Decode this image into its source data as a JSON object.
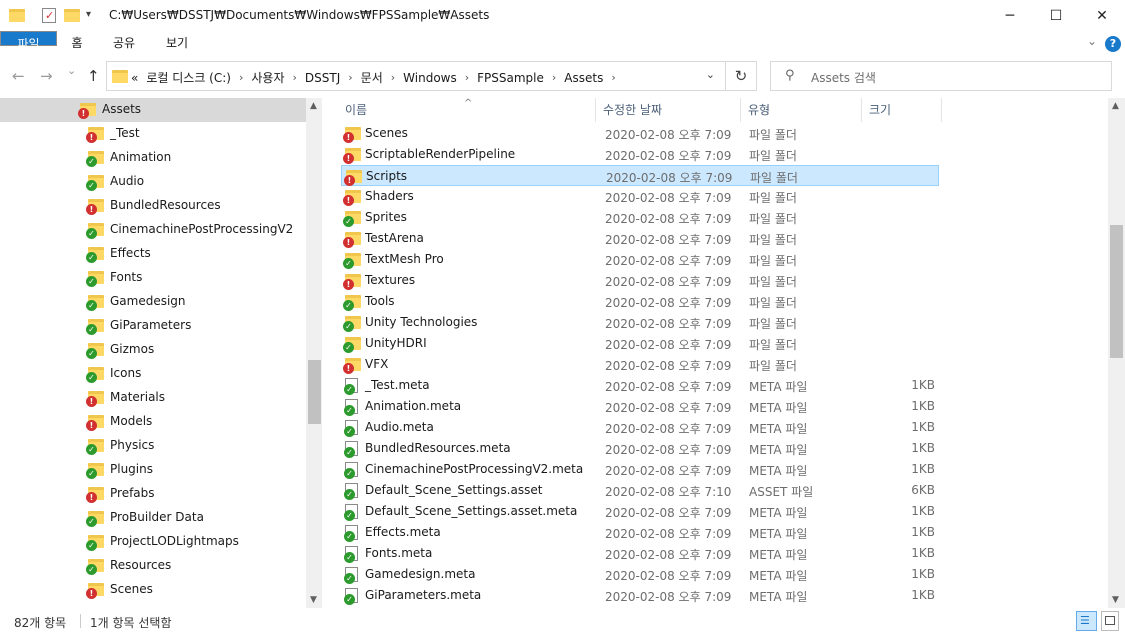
{
  "window": {
    "path": "C:₩Users₩DSSTJ₩Documents₩Windows₩FPSSample₩Assets",
    "minimize": "─",
    "maximize": "☐",
    "close": "✕"
  },
  "ribbon": {
    "tabs": [
      "파일",
      "홈",
      "공유",
      "보기"
    ],
    "help": "?"
  },
  "nav": {
    "back": "←",
    "forward": "→",
    "recent": "⌄",
    "up": "↑",
    "breadcrumb": [
      "«",
      "로컬 디스크 (C:)",
      "사용자",
      "DSSTJ",
      "문서",
      "Windows",
      "FPSSample",
      "Assets"
    ],
    "refresh": "↻",
    "search_placeholder": "Assets 검색"
  },
  "tree": {
    "selected": "Assets",
    "items": [
      {
        "label": "Assets",
        "status": "err"
      },
      {
        "label": "_Test",
        "status": "err"
      },
      {
        "label": "Animation",
        "status": "ok"
      },
      {
        "label": "Audio",
        "status": "ok"
      },
      {
        "label": "BundledResources",
        "status": "err"
      },
      {
        "label": "CinemachinePostProcessingV2",
        "status": "ok"
      },
      {
        "label": "Effects",
        "status": "ok"
      },
      {
        "label": "Fonts",
        "status": "ok"
      },
      {
        "label": "Gamedesign",
        "status": "ok"
      },
      {
        "label": "GiParameters",
        "status": "ok"
      },
      {
        "label": "Gizmos",
        "status": "ok"
      },
      {
        "label": "Icons",
        "status": "ok"
      },
      {
        "label": "Materials",
        "status": "err"
      },
      {
        "label": "Models",
        "status": "err"
      },
      {
        "label": "Physics",
        "status": "ok"
      },
      {
        "label": "Plugins",
        "status": "ok"
      },
      {
        "label": "Prefabs",
        "status": "err"
      },
      {
        "label": "ProBuilder Data",
        "status": "ok"
      },
      {
        "label": "ProjectLODLightmaps",
        "status": "ok"
      },
      {
        "label": "Resources",
        "status": "ok"
      },
      {
        "label": "Scenes",
        "status": "err"
      }
    ]
  },
  "columns": [
    "이름",
    "수정한 날짜",
    "유형",
    "크기"
  ],
  "files": [
    {
      "name": "Scenes",
      "date": "2020-02-08 오후 7:09",
      "type": "파일 폴더",
      "size": "",
      "kind": "folder",
      "status": "err"
    },
    {
      "name": "ScriptableRenderPipeline",
      "date": "2020-02-08 오후 7:09",
      "type": "파일 폴더",
      "size": "",
      "kind": "folder",
      "status": "err"
    },
    {
      "name": "Scripts",
      "date": "2020-02-08 오후 7:09",
      "type": "파일 폴더",
      "size": "",
      "kind": "folder",
      "status": "err",
      "selected": true
    },
    {
      "name": "Shaders",
      "date": "2020-02-08 오후 7:09",
      "type": "파일 폴더",
      "size": "",
      "kind": "folder",
      "status": "err"
    },
    {
      "name": "Sprites",
      "date": "2020-02-08 오후 7:09",
      "type": "파일 폴더",
      "size": "",
      "kind": "folder",
      "status": "ok"
    },
    {
      "name": "TestArena",
      "date": "2020-02-08 오후 7:09",
      "type": "파일 폴더",
      "size": "",
      "kind": "folder",
      "status": "err"
    },
    {
      "name": "TextMesh Pro",
      "date": "2020-02-08 오후 7:09",
      "type": "파일 폴더",
      "size": "",
      "kind": "folder",
      "status": "ok"
    },
    {
      "name": "Textures",
      "date": "2020-02-08 오후 7:09",
      "type": "파일 폴더",
      "size": "",
      "kind": "folder",
      "status": "err"
    },
    {
      "name": "Tools",
      "date": "2020-02-08 오후 7:09",
      "type": "파일 폴더",
      "size": "",
      "kind": "folder",
      "status": "ok"
    },
    {
      "name": "Unity Technologies",
      "date": "2020-02-08 오후 7:09",
      "type": "파일 폴더",
      "size": "",
      "kind": "folder",
      "status": "ok"
    },
    {
      "name": "UnityHDRI",
      "date": "2020-02-08 오후 7:09",
      "type": "파일 폴더",
      "size": "",
      "kind": "folder",
      "status": "ok"
    },
    {
      "name": "VFX",
      "date": "2020-02-08 오후 7:09",
      "type": "파일 폴더",
      "size": "",
      "kind": "folder",
      "status": "err"
    },
    {
      "name": "_Test.meta",
      "date": "2020-02-08 오후 7:09",
      "type": "META 파일",
      "size": "1KB",
      "kind": "file",
      "status": "ok"
    },
    {
      "name": "Animation.meta",
      "date": "2020-02-08 오후 7:09",
      "type": "META 파일",
      "size": "1KB",
      "kind": "file",
      "status": "ok"
    },
    {
      "name": "Audio.meta",
      "date": "2020-02-08 오후 7:09",
      "type": "META 파일",
      "size": "1KB",
      "kind": "file",
      "status": "ok"
    },
    {
      "name": "BundledResources.meta",
      "date": "2020-02-08 오후 7:09",
      "type": "META 파일",
      "size": "1KB",
      "kind": "file",
      "status": "ok"
    },
    {
      "name": "CinemachinePostProcessingV2.meta",
      "date": "2020-02-08 오후 7:09",
      "type": "META 파일",
      "size": "1KB",
      "kind": "file",
      "status": "ok"
    },
    {
      "name": "Default_Scene_Settings.asset",
      "date": "2020-02-08 오후 7:10",
      "type": "ASSET 파일",
      "size": "6KB",
      "kind": "file",
      "status": "ok"
    },
    {
      "name": "Default_Scene_Settings.asset.meta",
      "date": "2020-02-08 오후 7:09",
      "type": "META 파일",
      "size": "1KB",
      "kind": "file",
      "status": "ok"
    },
    {
      "name": "Effects.meta",
      "date": "2020-02-08 오후 7:09",
      "type": "META 파일",
      "size": "1KB",
      "kind": "file",
      "status": "ok"
    },
    {
      "name": "Fonts.meta",
      "date": "2020-02-08 오후 7:09",
      "type": "META 파일",
      "size": "1KB",
      "kind": "file",
      "status": "ok"
    },
    {
      "name": "Gamedesign.meta",
      "date": "2020-02-08 오후 7:09",
      "type": "META 파일",
      "size": "1KB",
      "kind": "file",
      "status": "ok"
    },
    {
      "name": "GiParameters.meta",
      "date": "2020-02-08 오후 7:09",
      "type": "META 파일",
      "size": "1KB",
      "kind": "file",
      "status": "ok"
    }
  ],
  "status": {
    "count": "82개 항목",
    "selection": "1개 항목 선택함"
  },
  "colors": {
    "accent": "#1979ca",
    "selection": "#cce8ff",
    "ok_badge": "#2c9a2c",
    "err_badge": "#d23030"
  }
}
